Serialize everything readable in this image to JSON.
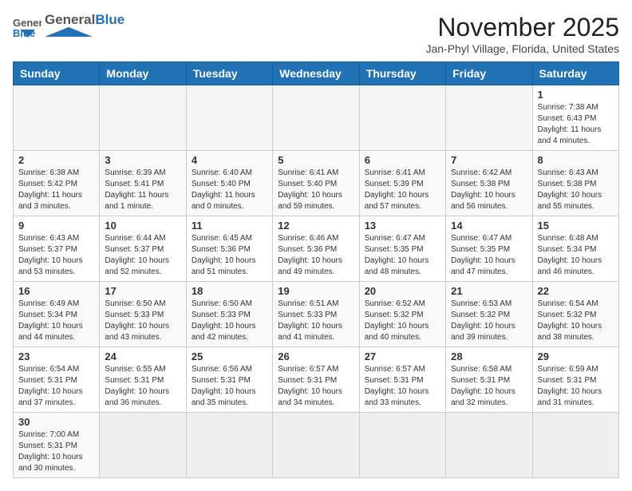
{
  "logo": {
    "text_general": "General",
    "text_blue": "Blue"
  },
  "header": {
    "title": "November 2025",
    "subtitle": "Jan-Phyl Village, Florida, United States"
  },
  "weekdays": [
    "Sunday",
    "Monday",
    "Tuesday",
    "Wednesday",
    "Thursday",
    "Friday",
    "Saturday"
  ],
  "weeks": [
    [
      {
        "day": "",
        "info": ""
      },
      {
        "day": "",
        "info": ""
      },
      {
        "day": "",
        "info": ""
      },
      {
        "day": "",
        "info": ""
      },
      {
        "day": "",
        "info": ""
      },
      {
        "day": "",
        "info": ""
      },
      {
        "day": "1",
        "info": "Sunrise: 7:38 AM\nSunset: 6:43 PM\nDaylight: 11 hours and 4 minutes."
      }
    ],
    [
      {
        "day": "2",
        "info": "Sunrise: 6:38 AM\nSunset: 5:42 PM\nDaylight: 11 hours and 3 minutes."
      },
      {
        "day": "3",
        "info": "Sunrise: 6:39 AM\nSunset: 5:41 PM\nDaylight: 11 hours and 1 minute."
      },
      {
        "day": "4",
        "info": "Sunrise: 6:40 AM\nSunset: 5:40 PM\nDaylight: 11 hours and 0 minutes."
      },
      {
        "day": "5",
        "info": "Sunrise: 6:41 AM\nSunset: 5:40 PM\nDaylight: 10 hours and 59 minutes."
      },
      {
        "day": "6",
        "info": "Sunrise: 6:41 AM\nSunset: 5:39 PM\nDaylight: 10 hours and 57 minutes."
      },
      {
        "day": "7",
        "info": "Sunrise: 6:42 AM\nSunset: 5:38 PM\nDaylight: 10 hours and 56 minutes."
      },
      {
        "day": "8",
        "info": "Sunrise: 6:43 AM\nSunset: 5:38 PM\nDaylight: 10 hours and 55 minutes."
      }
    ],
    [
      {
        "day": "9",
        "info": "Sunrise: 6:43 AM\nSunset: 5:37 PM\nDaylight: 10 hours and 53 minutes."
      },
      {
        "day": "10",
        "info": "Sunrise: 6:44 AM\nSunset: 5:37 PM\nDaylight: 10 hours and 52 minutes."
      },
      {
        "day": "11",
        "info": "Sunrise: 6:45 AM\nSunset: 5:36 PM\nDaylight: 10 hours and 51 minutes."
      },
      {
        "day": "12",
        "info": "Sunrise: 6:46 AM\nSunset: 5:36 PM\nDaylight: 10 hours and 49 minutes."
      },
      {
        "day": "13",
        "info": "Sunrise: 6:47 AM\nSunset: 5:35 PM\nDaylight: 10 hours and 48 minutes."
      },
      {
        "day": "14",
        "info": "Sunrise: 6:47 AM\nSunset: 5:35 PM\nDaylight: 10 hours and 47 minutes."
      },
      {
        "day": "15",
        "info": "Sunrise: 6:48 AM\nSunset: 5:34 PM\nDaylight: 10 hours and 46 minutes."
      }
    ],
    [
      {
        "day": "16",
        "info": "Sunrise: 6:49 AM\nSunset: 5:34 PM\nDaylight: 10 hours and 44 minutes."
      },
      {
        "day": "17",
        "info": "Sunrise: 6:50 AM\nSunset: 5:33 PM\nDaylight: 10 hours and 43 minutes."
      },
      {
        "day": "18",
        "info": "Sunrise: 6:50 AM\nSunset: 5:33 PM\nDaylight: 10 hours and 42 minutes."
      },
      {
        "day": "19",
        "info": "Sunrise: 6:51 AM\nSunset: 5:33 PM\nDaylight: 10 hours and 41 minutes."
      },
      {
        "day": "20",
        "info": "Sunrise: 6:52 AM\nSunset: 5:32 PM\nDaylight: 10 hours and 40 minutes."
      },
      {
        "day": "21",
        "info": "Sunrise: 6:53 AM\nSunset: 5:32 PM\nDaylight: 10 hours and 39 minutes."
      },
      {
        "day": "22",
        "info": "Sunrise: 6:54 AM\nSunset: 5:32 PM\nDaylight: 10 hours and 38 minutes."
      }
    ],
    [
      {
        "day": "23",
        "info": "Sunrise: 6:54 AM\nSunset: 5:31 PM\nDaylight: 10 hours and 37 minutes."
      },
      {
        "day": "24",
        "info": "Sunrise: 6:55 AM\nSunset: 5:31 PM\nDaylight: 10 hours and 36 minutes."
      },
      {
        "day": "25",
        "info": "Sunrise: 6:56 AM\nSunset: 5:31 PM\nDaylight: 10 hours and 35 minutes."
      },
      {
        "day": "26",
        "info": "Sunrise: 6:57 AM\nSunset: 5:31 PM\nDaylight: 10 hours and 34 minutes."
      },
      {
        "day": "27",
        "info": "Sunrise: 6:57 AM\nSunset: 5:31 PM\nDaylight: 10 hours and 33 minutes."
      },
      {
        "day": "28",
        "info": "Sunrise: 6:58 AM\nSunset: 5:31 PM\nDaylight: 10 hours and 32 minutes."
      },
      {
        "day": "29",
        "info": "Sunrise: 6:59 AM\nSunset: 5:31 PM\nDaylight: 10 hours and 31 minutes."
      }
    ],
    [
      {
        "day": "30",
        "info": "Sunrise: 7:00 AM\nSunset: 5:31 PM\nDaylight: 10 hours and 30 minutes."
      },
      {
        "day": "",
        "info": ""
      },
      {
        "day": "",
        "info": ""
      },
      {
        "day": "",
        "info": ""
      },
      {
        "day": "",
        "info": ""
      },
      {
        "day": "",
        "info": ""
      },
      {
        "day": "",
        "info": ""
      }
    ]
  ]
}
